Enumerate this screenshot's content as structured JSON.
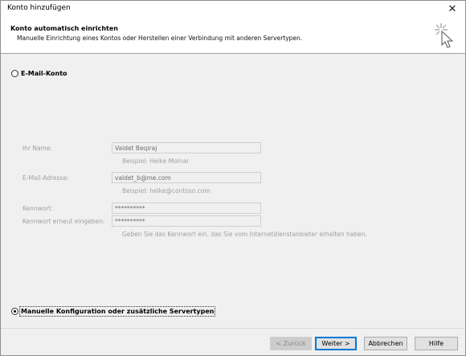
{
  "window": {
    "title": "Konto hinzufügen",
    "close_glyph": "✕"
  },
  "header": {
    "title": "Konto automatisch einrichten",
    "subtitle": "Manuelle Einrichtung eines Kontos oder Herstellen einer Verbindung mit anderen Servertypen.",
    "icon": "magic-wand-icon"
  },
  "options": {
    "email_account": {
      "label": "E-Mail-Konto",
      "selected": false
    },
    "manual_config": {
      "label": "Manuelle Konfiguration oder zusätzliche Servertypen",
      "selected": true
    }
  },
  "form": {
    "name": {
      "label": "Ihr Name:",
      "value": "Valdet Beqiraj",
      "hint": "Beispiel: Heike Molnar"
    },
    "email": {
      "label": "E-Mail-Adresse:",
      "value": "valdet_b@me.com",
      "hint": "Beispiel: heike@contoso.com"
    },
    "password": {
      "label": "Kennwort:",
      "value": "**********"
    },
    "password_repeat": {
      "label": "Kennwort erneut eingeben:",
      "value": "**********"
    },
    "password_hint": "Geben Sie das Kennwort ein, das Sie vom Internetdienstanbieter erhalten haben."
  },
  "buttons": {
    "back": "< Zurück",
    "next": "Weiter >",
    "cancel": "Abbrechen",
    "help": "Hilfe"
  },
  "colors": {
    "accent": "#0078d7",
    "dialog_bg": "#f0f0f0",
    "disabled_text": "#a0a0a0"
  }
}
